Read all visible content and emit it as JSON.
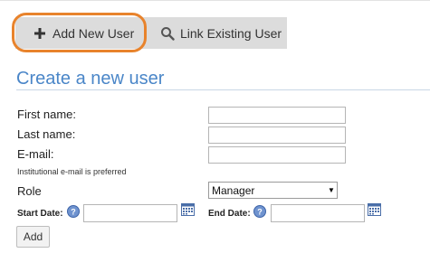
{
  "toolbar": {
    "add_new_user_label": "Add New User",
    "link_existing_user_label": "Link Existing User"
  },
  "form": {
    "title": "Create a new user",
    "first_name_label": "First name:",
    "last_name_label": "Last name:",
    "email_label": "E-mail:",
    "email_hint": "Institutional e-mail is preferred",
    "role_label": "Role",
    "role_selected": "Manager",
    "start_date_label": "Start Date:",
    "end_date_label": "End Date:",
    "add_button_label": "Add"
  },
  "colors": {
    "accent": "#4a86c8",
    "highlight_ring": "#e8832c",
    "button_bg": "#dcdcdc"
  },
  "icons": {
    "add": "plus-icon",
    "link": "search-icon",
    "help": "help-icon",
    "calendar": "calendar-icon"
  }
}
